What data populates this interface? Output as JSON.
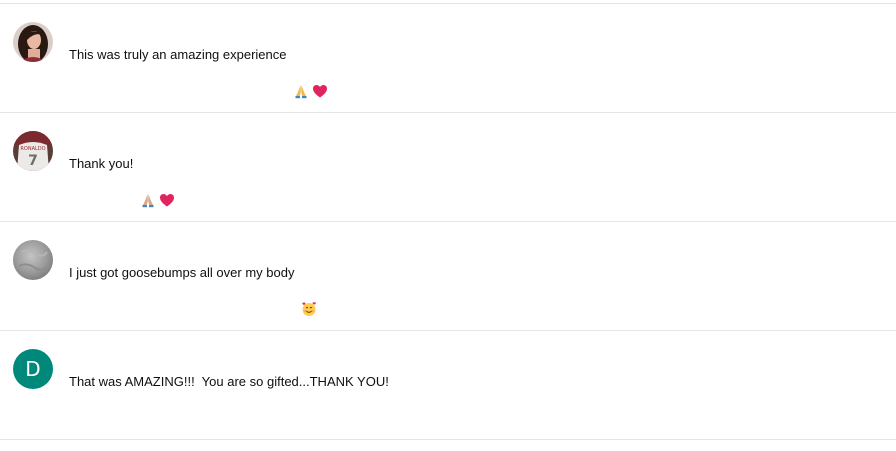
{
  "comments": [
    {
      "avatar": "woman-dark-hair-photo",
      "text": "This was truly an amazing experience ",
      "emojis": [
        "folded-hands-emoji",
        "red-heart-emoji"
      ]
    },
    {
      "avatar": "jersey-number-7-photo",
      "text": "Thank you! ",
      "emojis": [
        "folded-hands-light-emoji",
        "red-heart-emoji"
      ]
    },
    {
      "avatar": "gray-texture-photo",
      "text": "I just got goosebumps all over my body ",
      "emojis": [
        "smiling-face-with-hearts-emoji"
      ]
    },
    {
      "avatar_letter": "D",
      "avatar_color": "#00897b",
      "text": "That was AMAZING!!!  You are so gifted...THANK YOU!",
      "emojis": []
    }
  ],
  "colors": {
    "divider": "#e5e5e5",
    "text": "#0f0f0f",
    "letter_avatar": "#00897b",
    "heart": "#e0245e"
  }
}
